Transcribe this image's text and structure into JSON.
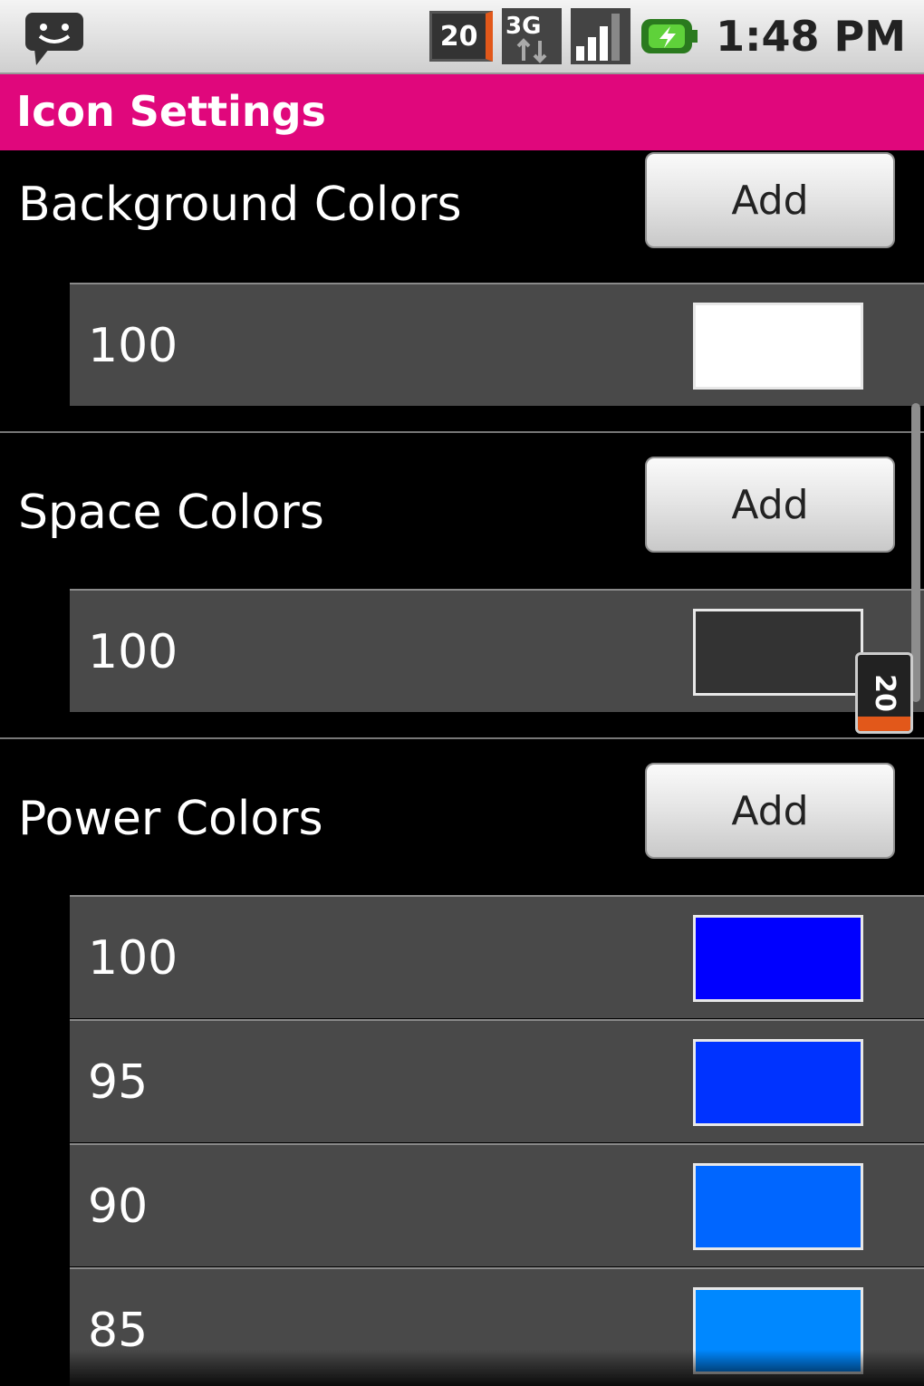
{
  "status_bar": {
    "notification_icon": "chat-smiley-icon",
    "battery_percent_small": "20",
    "network_label": "3G",
    "signal_icon": "signal-bars-icon",
    "charging_icon": "battery-charging-icon",
    "time": "1:48 PM"
  },
  "title_bar": {
    "title": "Icon Settings",
    "color": "#e0077c"
  },
  "sections": [
    {
      "title": "Background Colors",
      "add_label": "Add",
      "rows": [
        {
          "value": "100",
          "color": "#ffffff"
        }
      ]
    },
    {
      "title": "Space Colors",
      "add_label": "Add",
      "rows": [
        {
          "value": "100",
          "color": "#333333"
        }
      ]
    },
    {
      "title": "Power Colors",
      "add_label": "Add",
      "rows": [
        {
          "value": "100",
          "color": "#0000ff"
        },
        {
          "value": "95",
          "color": "#0033ff"
        },
        {
          "value": "90",
          "color": "#0066ff"
        },
        {
          "value": "85",
          "color": "#0088ff"
        }
      ]
    }
  ],
  "battery_widget": {
    "value": "20",
    "fill_color": "#e2581a"
  }
}
